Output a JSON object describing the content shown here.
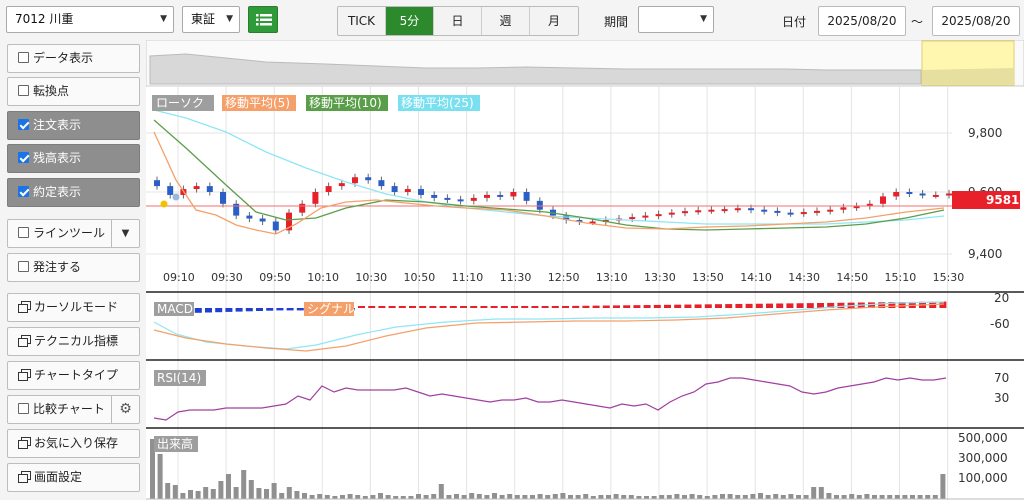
{
  "toolbar": {
    "symbol": "7012 川重",
    "market": "東証",
    "intervals": [
      {
        "label": "TICK",
        "active": false
      },
      {
        "label": "5分",
        "active": true
      },
      {
        "label": "日",
        "active": false
      },
      {
        "label": "週",
        "active": false
      },
      {
        "label": "月",
        "active": false
      }
    ],
    "period_label": "期間",
    "period_value": "",
    "date_label": "日付",
    "date_from": "2025/08/20",
    "date_sep": "〜",
    "date_to": "2025/08/20"
  },
  "sidebar": {
    "data_display": "データ表示",
    "turning_point": "転換点",
    "order_display": "注文表示",
    "balance_display": "残高表示",
    "execution_display": "約定表示",
    "line_tool": "ラインツール",
    "order": "発注する",
    "cursor_mode": "カーソルモード",
    "technical": "テクニカル指標",
    "chart_type": "チャートタイプ",
    "compare_chart": "比較チャート",
    "favorites_save": "お気に入り保存",
    "screen_settings": "画面設定"
  },
  "chart_data": {
    "type": "candlestick",
    "legend": [
      {
        "name": "ローソク",
        "color": "#9e9e9e"
      },
      {
        "name": "移動平均(5)",
        "color": "#f5a06a"
      },
      {
        "name": "移動平均(10)",
        "color": "#5a9e4a"
      },
      {
        "name": "移動平均(25)",
        "color": "#7ae0f0"
      }
    ],
    "current_price": "9581",
    "price_ticks": [
      "9,800",
      "9,600",
      "9,400"
    ],
    "time_ticks": [
      "09:10",
      "09:30",
      "09:50",
      "10:10",
      "10:30",
      "10:50",
      "11:10",
      "11:30",
      "12:50",
      "13:10",
      "13:30",
      "13:50",
      "14:10",
      "14:30",
      "14:50",
      "15:10",
      "15:30"
    ],
    "price_range": [
      9350,
      9900
    ],
    "macd_label": "MACD",
    "macd_signal_label": "シグナル",
    "macd_ticks": [
      "20",
      "-60"
    ],
    "rsi_label": "RSI(14)",
    "rsi_ticks": [
      "70",
      "30"
    ],
    "volume_label": "出来高",
    "volume_ticks": [
      "500,000",
      "300,000",
      "100,000"
    ],
    "volume": [
      600000,
      450000,
      160000,
      140000,
      60000,
      90000,
      80000,
      120000,
      100000,
      180000,
      250000,
      120000,
      290000,
      190000,
      110000,
      100000,
      160000,
      60000,
      120000,
      80000,
      60000,
      40000,
      50000,
      40000,
      30000,
      40000,
      50000,
      40000,
      30000,
      40000,
      60000,
      40000,
      30000,
      30000,
      30000,
      50000,
      40000,
      50000,
      150000,
      40000,
      50000,
      40000,
      60000,
      50000,
      40000,
      60000,
      40000,
      50000,
      40000,
      40000,
      40000,
      50000,
      40000,
      50000,
      60000,
      40000,
      40000,
      50000,
      30000,
      40000,
      40000,
      50000,
      40000,
      40000,
      30000,
      30000,
      30000,
      40000,
      40000,
      50000,
      40000,
      50000,
      40000,
      30000,
      40000,
      50000,
      50000,
      40000,
      40000,
      50000,
      60000,
      40000,
      50000,
      40000,
      50000,
      40000,
      40000,
      120000,
      120000,
      60000,
      40000,
      40000,
      50000,
      40000,
      50000,
      40000,
      40000,
      40000,
      40000,
      40000,
      40000,
      40000,
      40000,
      40000,
      250000
    ]
  }
}
